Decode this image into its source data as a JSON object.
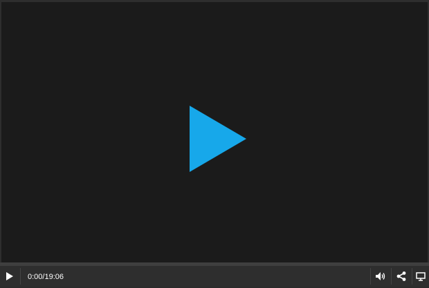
{
  "player": {
    "current_time": "0:00",
    "time_separator": "/",
    "duration": "19:06",
    "progress_fraction": 0,
    "accent_color": "#17a8ea"
  },
  "icons": {
    "big_play": "play-icon",
    "play": "play-icon",
    "volume": "volume-icon",
    "share": "share-icon",
    "screen": "monitor-icon"
  },
  "colors": {
    "video_background": "#1b1b1b",
    "control_bar": "#2e2e2e",
    "icon": "#ffffff"
  }
}
